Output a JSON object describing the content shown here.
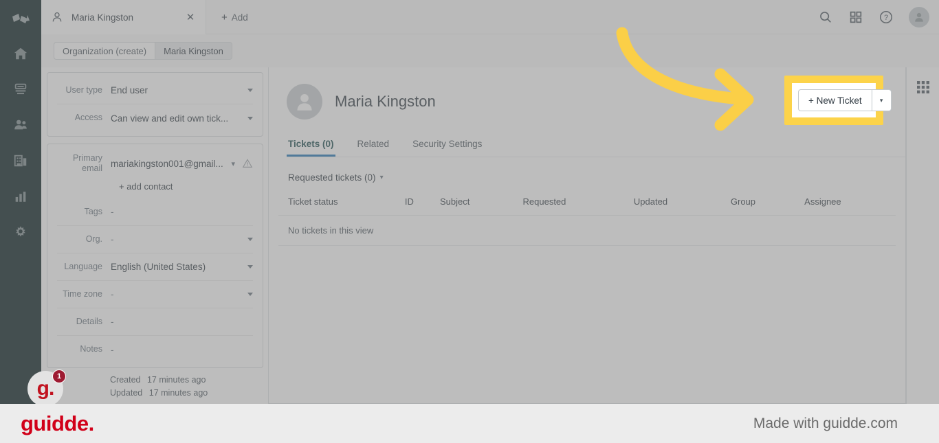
{
  "nav_rail": {
    "logo_name": "zendesk-logo",
    "items": [
      {
        "name": "home",
        "label": "Home"
      },
      {
        "name": "views",
        "label": "Views"
      },
      {
        "name": "customers",
        "label": "Customers"
      },
      {
        "name": "organizations",
        "label": "Organizations"
      },
      {
        "name": "reporting",
        "label": "Reporting"
      },
      {
        "name": "settings",
        "label": "Settings"
      }
    ]
  },
  "topbar": {
    "active_tab": {
      "label": "Maria Kingston",
      "icon": "user-icon",
      "close_label": "✕"
    },
    "add_tab": {
      "plus": "+",
      "label": "Add"
    },
    "icons": [
      {
        "name": "search-icon",
        "label": "Search"
      },
      {
        "name": "apps-grid-icon",
        "label": "Apps"
      },
      {
        "name": "help-icon",
        "label": "Help"
      }
    ],
    "avatar_name": "user-avatar"
  },
  "subtabs": {
    "items": [
      {
        "label": "Organization (create)",
        "selected": false
      },
      {
        "label": "Maria Kingston",
        "selected": true
      }
    ]
  },
  "properties": {
    "card1": [
      {
        "label": "User type",
        "value": "End user",
        "has_caret": true
      },
      {
        "label": "Access",
        "value": "Can view and edit own tick...",
        "has_caret": true
      }
    ],
    "email": {
      "label": "Primary email",
      "value": "mariakingston001@gmail...",
      "has_chevron": true,
      "warning_icon": "warning-triangle-icon"
    },
    "add_contact": "+ add contact",
    "card2": [
      {
        "label": "Tags",
        "value": "-",
        "has_caret": false
      },
      {
        "label": "Org.",
        "value": "-",
        "has_caret": true
      },
      {
        "label": "Language",
        "value": "English (United States)",
        "has_caret": true
      },
      {
        "label": "Time zone",
        "value": "-",
        "has_caret": true
      },
      {
        "label": "Details",
        "value": "-",
        "has_caret": false
      },
      {
        "label": "Notes",
        "value": "-",
        "has_caret": false
      }
    ],
    "timestamps": [
      {
        "key": "Created",
        "value": "17 minutes ago"
      },
      {
        "key": "Updated",
        "value": "17 minutes ago"
      }
    ]
  },
  "main": {
    "user_name": "Maria Kingston",
    "avatar_name": "profile-avatar",
    "tabs": [
      {
        "label": "Tickets (0)",
        "active": true
      },
      {
        "label": "Related",
        "active": false
      },
      {
        "label": "Security Settings",
        "active": false
      }
    ],
    "requested_tickets": "Requested tickets (0)",
    "table": {
      "headers": [
        "Ticket status",
        "ID",
        "Subject",
        "Requested",
        "Updated",
        "Group",
        "Assignee"
      ],
      "empty_message": "No tickets in this view",
      "rows": []
    },
    "new_ticket_button": "+ New Ticket"
  },
  "apps_rail": {
    "icon": "apps-grid-icon"
  },
  "annotation": {
    "arrow_color": "#fbcf47",
    "highlight_color": "#fcd34a",
    "badge_letter": "g.",
    "badge_count": "1"
  },
  "footer": {
    "logo": "guidde.",
    "made_with": "Made with guidde.com",
    "logo_color": "#d10019"
  }
}
